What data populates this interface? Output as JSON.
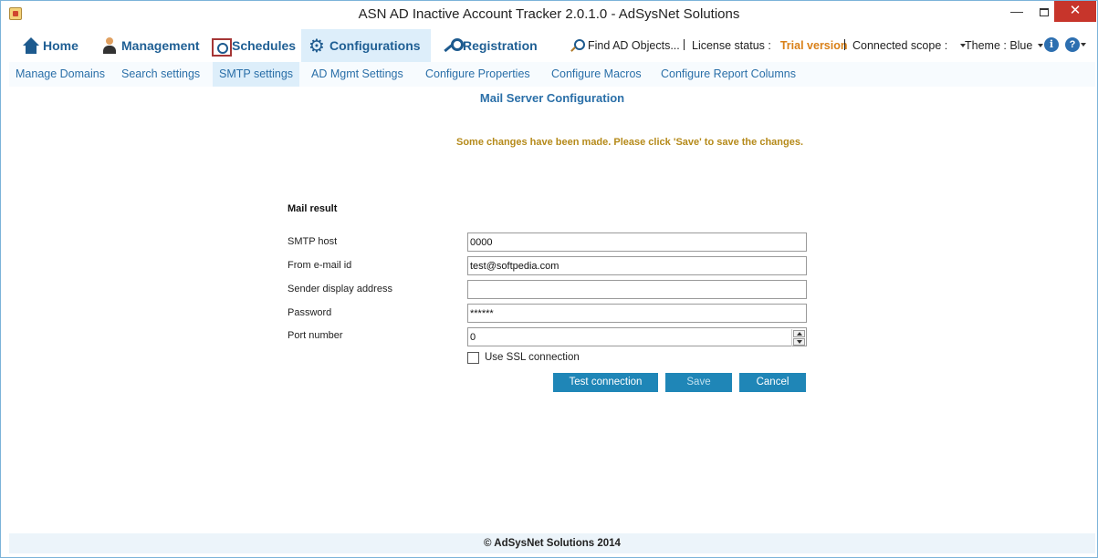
{
  "window": {
    "title": "ASN AD Inactive Account Tracker 2.0.1.0 - AdSysNet Solutions",
    "controls": {
      "minimize": "—",
      "close": "✕"
    }
  },
  "menu": {
    "items": [
      {
        "label": "Home",
        "icon": "home-icon"
      },
      {
        "label": "Management",
        "icon": "user-icon"
      },
      {
        "label": "Schedules",
        "icon": "calendar-icon"
      },
      {
        "label": "Configurations",
        "icon": "gear-icon"
      },
      {
        "label": "Registration",
        "icon": "key-icon"
      }
    ],
    "active": "Configurations"
  },
  "status": {
    "find": "Find AD Objects...",
    "license_label": "License status :",
    "license_value": "Trial version",
    "scope_label": "Connected scope :",
    "theme_label": "Theme : Blue",
    "info_glyph": "i",
    "help_glyph": "?"
  },
  "submenu": {
    "items": [
      "Manage Domains",
      "Search settings",
      "SMTP settings",
      "AD Mgmt Settings",
      "Configure Properties",
      "Configure Macros",
      "Configure Report Columns"
    ],
    "active": "SMTP settings"
  },
  "content": {
    "title": "Mail Server Configuration",
    "notice": "Some changes have been made. Please click 'Save' to save the changes.",
    "form_title": "Mail result",
    "fields": {
      "smtp_host": {
        "label": "SMTP host",
        "value": "0000"
      },
      "from_email": {
        "label": "From e-mail id",
        "value": "test@softpedia.com"
      },
      "sender_display": {
        "label": "Sender display address",
        "value": ""
      },
      "password": {
        "label": "Password",
        "value": "******"
      },
      "port": {
        "label": "Port number",
        "value": "0"
      }
    },
    "ssl_label": "Use SSL connection",
    "ssl_checked": false,
    "buttons": {
      "test": "Test connection",
      "save": "Save",
      "cancel": "Cancel"
    }
  },
  "footer": {
    "text": "© AdSysNet Solutions 2014"
  },
  "colors": {
    "accent": "#1f86b7",
    "menu_text": "#1f5f94",
    "notice": "#b58a1a",
    "trial": "#d98018",
    "close": "#c7352b"
  }
}
